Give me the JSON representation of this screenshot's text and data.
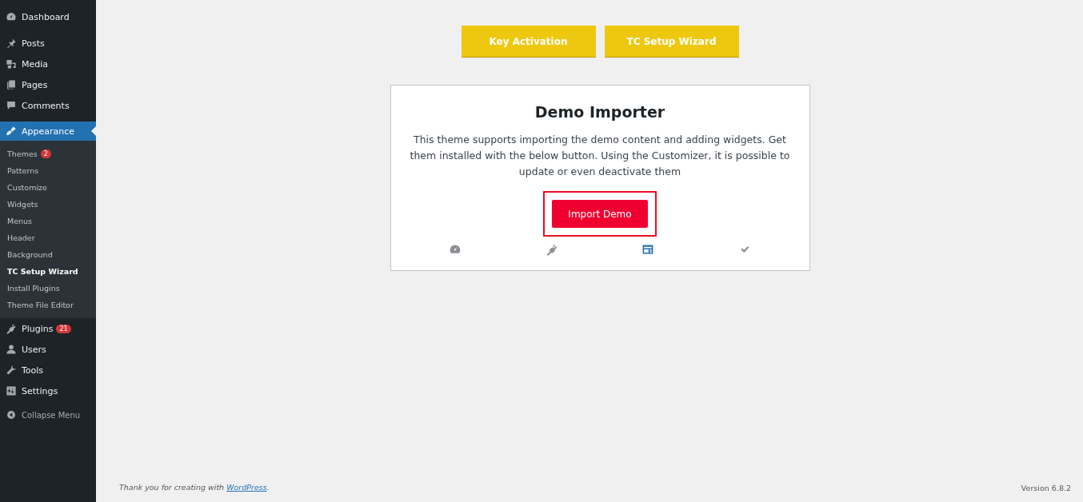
{
  "sidebar": {
    "items": [
      {
        "label": "Dashboard",
        "selected": false
      },
      {
        "label": "Posts",
        "selected": false
      },
      {
        "label": "Media",
        "selected": false
      },
      {
        "label": "Pages",
        "selected": false
      },
      {
        "label": "Comments",
        "selected": false
      },
      {
        "label": "Appearance",
        "selected": true,
        "children": [
          {
            "label": "Themes",
            "badge": "2",
            "selected": false
          },
          {
            "label": "Patterns",
            "selected": false
          },
          {
            "label": "Customize",
            "selected": false
          },
          {
            "label": "Widgets",
            "selected": false
          },
          {
            "label": "Menus",
            "selected": false
          },
          {
            "label": "Header",
            "selected": false
          },
          {
            "label": "Background",
            "selected": false
          },
          {
            "label": "TC Setup Wizard",
            "selected": true
          },
          {
            "label": "Install Plugins",
            "selected": false
          },
          {
            "label": "Theme File Editor",
            "selected": false
          }
        ]
      },
      {
        "label": "Plugins",
        "badge": "21",
        "selected": false
      },
      {
        "label": "Users",
        "selected": false
      },
      {
        "label": "Tools",
        "selected": false
      },
      {
        "label": "Settings",
        "selected": false
      }
    ],
    "collapse": "Collapse Menu"
  },
  "top_buttons": [
    "Key Activation",
    "TC Setup Wizard"
  ],
  "card": {
    "title": "Demo Importer",
    "text": "This theme supports importing the demo content and adding widgets. Get them installed with the below button. Using the Customizer, it is possible to update or even deactivate them",
    "button": "Import Demo",
    "steps": [
      {
        "selected": false
      },
      {
        "selected": false
      },
      {
        "selected": true
      },
      {
        "selected": false
      }
    ]
  },
  "footer": {
    "text": "Thank you for creating with",
    "link": "WordPress",
    "end": ".",
    "version": "Version 6.8.2"
  }
}
